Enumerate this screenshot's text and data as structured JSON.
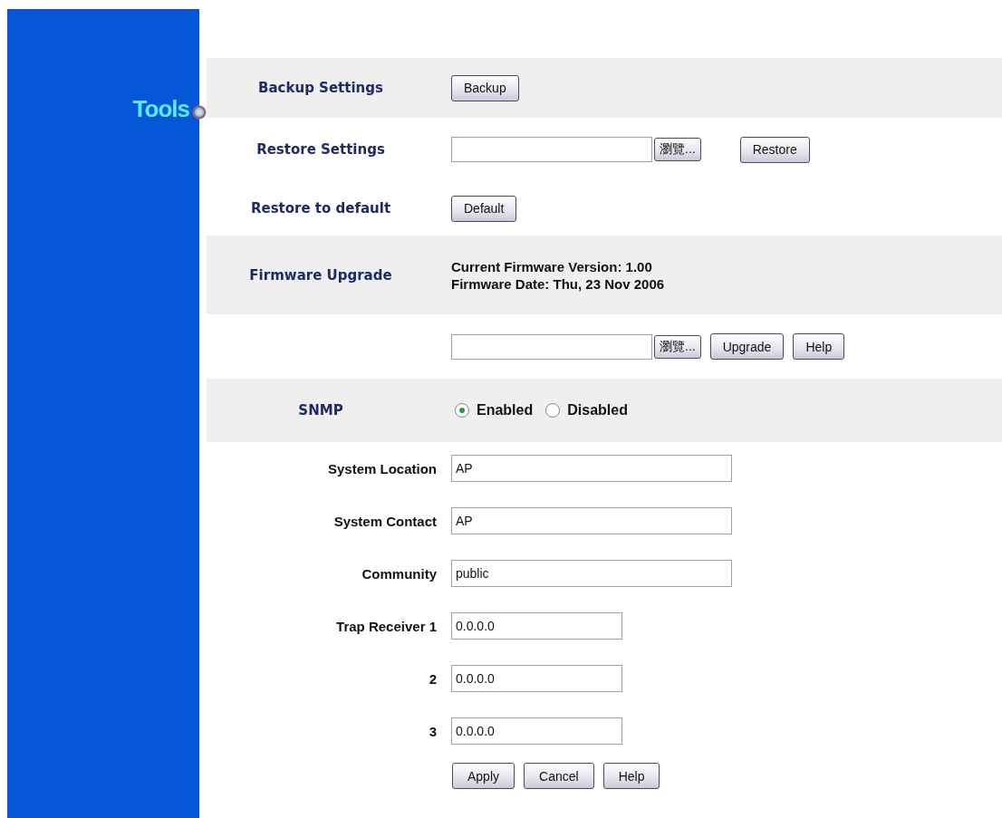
{
  "sidebar_title": "Tools",
  "backup": {
    "label": "Backup Settings",
    "button": "Backup"
  },
  "restore": {
    "label": "Restore Settings",
    "browse_button": "瀏覽...",
    "button": "Restore"
  },
  "restore_default": {
    "label": "Restore to default",
    "button": "Default"
  },
  "firmware": {
    "label": "Firmware Upgrade",
    "version": "Current Firmware Version: 1.00",
    "date": "Firmware Date: Thu, 23 Nov 2006",
    "browse_button": "瀏覽...",
    "buttons": [
      "Upgrade",
      "Help"
    ]
  },
  "snmp": {
    "label": "SNMP",
    "options": [
      {
        "label": "Enabled",
        "selected": true
      },
      {
        "label": "Disabled",
        "selected": false
      }
    ]
  },
  "fields": [
    {
      "label": "System Location",
      "value": "AP",
      "kind": "wide"
    },
    {
      "label": "System Contact",
      "value": "AP",
      "kind": "wide"
    },
    {
      "label": "Community",
      "value": "public",
      "kind": "wide"
    },
    {
      "label": "Trap Receiver 1",
      "value": "0.0.0.0",
      "kind": "narrow"
    },
    {
      "label": "2",
      "value": "0.0.0.0",
      "kind": "narrow"
    },
    {
      "label": "3",
      "value": "0.0.0.0",
      "kind": "narrow"
    }
  ],
  "buttons": [
    "Apply",
    "Cancel",
    "Help"
  ]
}
